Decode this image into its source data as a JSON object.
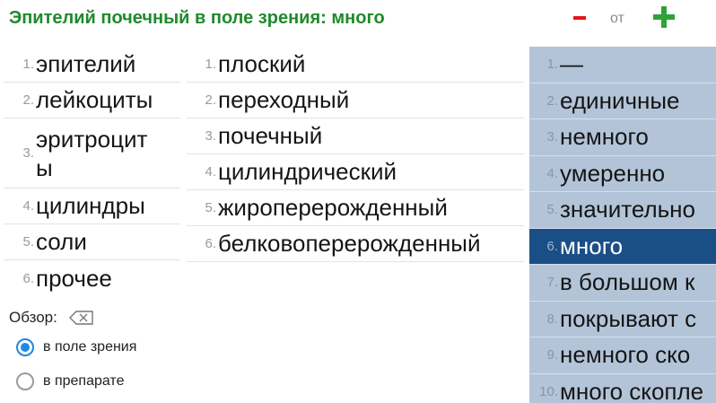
{
  "header": {
    "title": "Эпителий почечный в поле зрения: много",
    "from_label": "от",
    "minus_label": "−",
    "plus_label": "+"
  },
  "categories": [
    {
      "num": "1.",
      "label": "эпителий"
    },
    {
      "num": "2.",
      "label": "лейкоциты"
    },
    {
      "num": "3.",
      "label": "эритроцит ы"
    },
    {
      "num": "4.",
      "label": "цилиндры"
    },
    {
      "num": "5.",
      "label": "соли"
    },
    {
      "num": "6.",
      "label": "прочее"
    }
  ],
  "subtypes": [
    {
      "num": "1.",
      "label": "плоский"
    },
    {
      "num": "2.",
      "label": "переходный"
    },
    {
      "num": "3.",
      "label": "почечный"
    },
    {
      "num": "4.",
      "label": "цилиндрический"
    },
    {
      "num": "5.",
      "label": "жироперерожденный"
    },
    {
      "num": "6.",
      "label": "белковоперерожденный"
    }
  ],
  "quantities": [
    {
      "num": "1.",
      "label": "—"
    },
    {
      "num": "2.",
      "label": "единичные"
    },
    {
      "num": "3.",
      "label": "немного"
    },
    {
      "num": "4.",
      "label": "умеренно"
    },
    {
      "num": "5.",
      "label": "значительно"
    },
    {
      "num": "6.",
      "label": "много"
    },
    {
      "num": "7.",
      "label": "в большом к"
    },
    {
      "num": "8.",
      "label": "покрывают с"
    },
    {
      "num": "9.",
      "label": "немного ско"
    },
    {
      "num": "10.",
      "label": "много скопле"
    }
  ],
  "selected_quantity_index": 5,
  "review": {
    "label": "Обзор:",
    "options": [
      {
        "label": "в поле зрения",
        "checked": true
      },
      {
        "label": "в препарате",
        "checked": false
      }
    ]
  },
  "colors": {
    "title": "#1f8a2c",
    "minus": "#e4141b",
    "plus": "#2fa23a",
    "quantity_panel": "#b3c4d8",
    "selected": "#1a4f86",
    "radio_accent": "#1e88e5"
  }
}
